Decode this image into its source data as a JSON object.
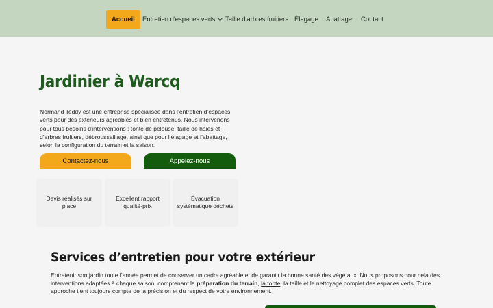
{
  "nav": {
    "items": [
      {
        "label": "Accueil",
        "active": true
      },
      {
        "label": "Entretien d'espaces verts",
        "has_dropdown": true
      },
      {
        "label": "Taille d'arbres fruitiers"
      },
      {
        "label": "Élagage"
      },
      {
        "label": "Abattage"
      },
      {
        "label": "Contact"
      }
    ]
  },
  "hero": {
    "title": "Jardinier à Warcq",
    "text": "Normand Teddy est une entreprise spécialisée dans l’entretien d’espaces verts pour des extérieurs agréables et bien entretenus. Nous intervenons pour tous besoins d’interventions : tonte de pelouse, taille de haies et d’arbres fruitiers, débroussaillage, ainsi que pour l’élagage et l’abattage, selon la configuration du terrain et la saison.",
    "btn_contact": "Contactez-nous",
    "btn_call": "Appelez-nous"
  },
  "features": [
    "Devis réalisés sur place",
    "Excellent rapport qualité-prix",
    "Évacuation systématique déchets"
  ],
  "services": {
    "title": "Services d’entretien pour votre extérieur",
    "text_1": "Entretenir son jardin toute l’année permet de conserver un cadre agréable et de garantir la bonne santé des végétaux. Nous proposons pour cela des interventions adaptées à chaque saison, comprenant la ",
    "bold": "préparation du terrain",
    "text_2": ", ",
    "link": "la tonte",
    "text_3": ", la taille et le nettoyage complet des espaces verts. Toute approche tient toujours compte de la précision et du respect de votre environnement."
  },
  "colors": {
    "nav_bg": "#c4d6c0",
    "accent_orange": "#f3a81c",
    "brand_green": "#145c0d",
    "title_green": "#1f5b1e"
  }
}
